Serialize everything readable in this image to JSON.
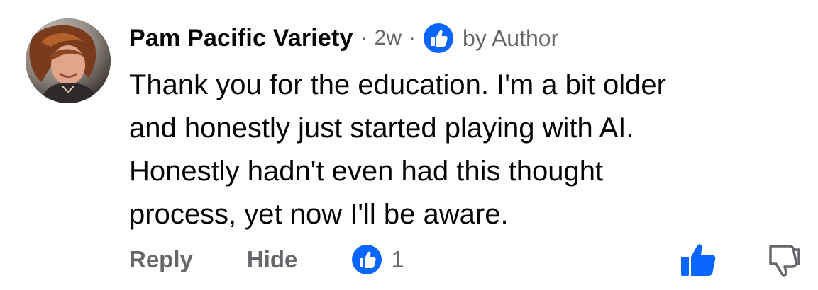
{
  "comment": {
    "author": "Pam Pacific Variety",
    "separator": "·",
    "time": "2w",
    "badge_icon": "thumbs-up-icon",
    "badge_label": "by Author",
    "text": "Thank you for the education. I'm a bit older\nand honestly just started playing with AI.\nHonestly hadn't even had this thought\nprocess, yet now I'll be aware.",
    "actions": {
      "reply_label": "Reply",
      "hide_label": "Hide",
      "reaction_icon": "thumbs-up-icon",
      "reaction_count": "1",
      "like_icon": "thumbs-up-filled-icon",
      "dislike_icon": "thumbs-down-outline-icon"
    }
  },
  "colors": {
    "text_primary": "#050505",
    "text_secondary": "#65676b",
    "accent_blue": "#0866ff"
  }
}
